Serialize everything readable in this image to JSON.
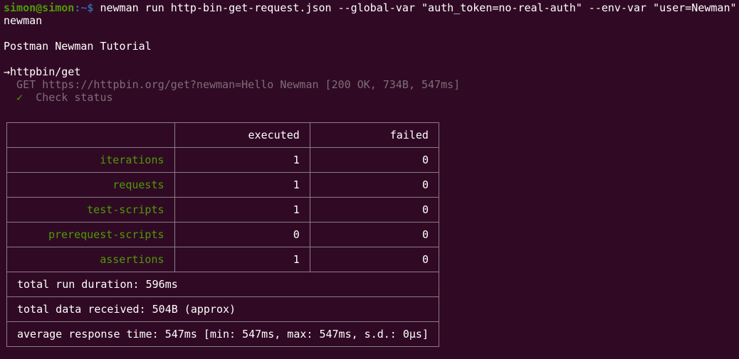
{
  "prompt": {
    "user": "simon@simon",
    "path": ":~$ ",
    "command": "newman run http-bin-get-request.json --global-var \"auth_token=no-real-auth\" --env-var \"user=Newman\""
  },
  "output": {
    "tool": "newman",
    "collection": "Postman Newman Tutorial",
    "arrow": "→",
    "request_name": "httpbin/get",
    "request_line": "  GET https://httpbin.org/get?newman=Hello Newman [200 OK, 734B, 547ms]",
    "check_mark": "  ✓",
    "check_text": "  Check status"
  },
  "summary": {
    "headers": [
      "executed",
      "failed"
    ],
    "rows": [
      {
        "label": "iterations",
        "executed": "1",
        "failed": "0"
      },
      {
        "label": "requests",
        "executed": "1",
        "failed": "0"
      },
      {
        "label": "test-scripts",
        "executed": "1",
        "failed": "0"
      },
      {
        "label": "prerequest-scripts",
        "executed": "0",
        "failed": "0"
      },
      {
        "label": "assertions",
        "executed": "1",
        "failed": "0"
      }
    ],
    "duration": "total run duration: 596ms",
    "data_received": "total data received: 504B (approx)",
    "avg_response": "average response time: 547ms [min: 547ms, max: 547ms, s.d.: 0µs]"
  }
}
